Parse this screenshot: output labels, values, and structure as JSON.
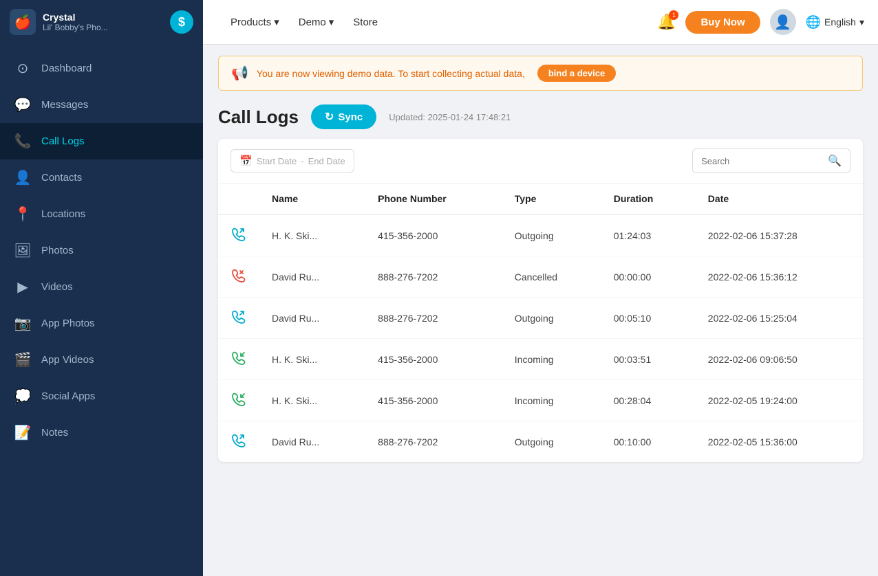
{
  "brand": {
    "name": "Crystal",
    "sub": "Lil' Bobby's Pho...",
    "dollar": "$"
  },
  "nav": {
    "products": "Products",
    "demo": "Demo",
    "store": "Store",
    "buy_now": "Buy Now",
    "language": "English"
  },
  "banner": {
    "text": "You are now viewing demo data. To start collecting actual data,",
    "btn": "bind a device"
  },
  "page": {
    "title": "Call Logs",
    "sync": "Sync",
    "updated": "Updated: 2025-01-24 17:48:21"
  },
  "toolbar": {
    "start_placeholder": "Start Date",
    "end_placeholder": "End Date",
    "search_placeholder": "Search"
  },
  "table": {
    "headers": [
      "",
      "Name",
      "Phone Number",
      "Type",
      "Duration",
      "Date"
    ],
    "rows": [
      {
        "type": "outgoing",
        "name": "H. K. Ski...",
        "phone": "415-356-2000",
        "call_type": "Outgoing",
        "duration": "01:24:03",
        "date": "2022-02-06 15:37:28"
      },
      {
        "type": "cancelled",
        "name": "David Ru...",
        "phone": "888-276-7202",
        "call_type": "Cancelled",
        "duration": "00:00:00",
        "date": "2022-02-06 15:36:12"
      },
      {
        "type": "outgoing",
        "name": "David Ru...",
        "phone": "888-276-7202",
        "call_type": "Outgoing",
        "duration": "00:05:10",
        "date": "2022-02-06 15:25:04"
      },
      {
        "type": "incoming",
        "name": "H. K. Ski...",
        "phone": "415-356-2000",
        "call_type": "Incoming",
        "duration": "00:03:51",
        "date": "2022-02-06 09:06:50"
      },
      {
        "type": "incoming",
        "name": "H. K. Ski...",
        "phone": "415-356-2000",
        "call_type": "Incoming",
        "duration": "00:28:04",
        "date": "2022-02-05 19:24:00"
      },
      {
        "type": "outgoing",
        "name": "David Ru...",
        "phone": "888-276-7202",
        "call_type": "Outgoing",
        "duration": "00:10:00",
        "date": "2022-02-05 15:36:00"
      }
    ]
  },
  "sidebar": {
    "items": [
      {
        "id": "dashboard",
        "label": "Dashboard",
        "icon": "⊙"
      },
      {
        "id": "messages",
        "label": "Messages",
        "icon": "💬"
      },
      {
        "id": "call-logs",
        "label": "Call Logs",
        "icon": "📞"
      },
      {
        "id": "contacts",
        "label": "Contacts",
        "icon": "👤"
      },
      {
        "id": "locations",
        "label": "Locations",
        "icon": "📍"
      },
      {
        "id": "photos",
        "label": "Photos",
        "icon": "🖼"
      },
      {
        "id": "videos",
        "label": "Videos",
        "icon": "▶"
      },
      {
        "id": "app-photos",
        "label": "App Photos",
        "icon": "📷"
      },
      {
        "id": "app-videos",
        "label": "App Videos",
        "icon": "🎬"
      },
      {
        "id": "social-apps",
        "label": "Social Apps",
        "icon": "💭"
      },
      {
        "id": "notes",
        "label": "Notes",
        "icon": "📝"
      }
    ]
  }
}
